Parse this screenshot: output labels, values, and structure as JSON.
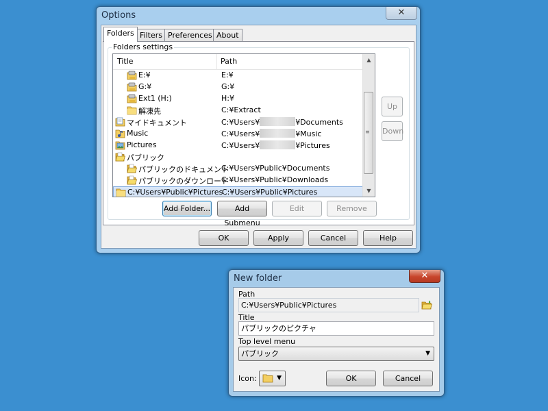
{
  "options_window": {
    "title": "Options",
    "close_glyph": "✕",
    "tabs": [
      "Folders",
      "Filters",
      "Preferences",
      "About"
    ],
    "group_label": "Folders settings",
    "columns": [
      "Title",
      "Path"
    ],
    "rows": [
      {
        "title": "E:¥",
        "path": "E:¥",
        "icon": "drive-icon",
        "indent": 1
      },
      {
        "title": "G:¥",
        "path": "G:¥",
        "icon": "drive-icon",
        "indent": 1
      },
      {
        "title": "Ext1 (H:)",
        "path": "H:¥",
        "icon": "drive-icon",
        "indent": 1
      },
      {
        "title": "解凍先",
        "path": "C:¥Extract",
        "icon": "folder-icon",
        "indent": 1
      },
      {
        "title": "マイドキュメント",
        "path_prefix": "C:¥Users¥",
        "path_suffix": "¥Documents",
        "icon": "documents-icon",
        "indent": 0
      },
      {
        "title": "Music",
        "path_prefix": "C:¥Users¥",
        "path_suffix": "¥Music",
        "icon": "music-icon",
        "indent": 0
      },
      {
        "title": "Pictures",
        "path_prefix": "C:¥Users¥",
        "path_suffix": "¥Pictures",
        "icon": "pictures-icon",
        "indent": 0
      },
      {
        "title": "パブリック",
        "path": "",
        "icon": "open-folder-icon",
        "indent": 0
      },
      {
        "title": "パブリックのドキュメント",
        "path": "C:¥Users¥Public¥Documents",
        "icon": "open-folder-icon",
        "indent": 1
      },
      {
        "title": "パブリックのダウンロード",
        "path": "C:¥Users¥Public¥Downloads",
        "icon": "open-folder-icon",
        "indent": 1
      },
      {
        "title": "C:¥Users¥Public¥Pictures",
        "path": "C:¥Users¥Public¥Pictures",
        "icon": "folder-icon",
        "indent": 0,
        "selected": true
      }
    ],
    "side_buttons": {
      "up": "Up",
      "down": "Down"
    },
    "list_buttons": {
      "add_folder": "Add Folder...",
      "add_submenu": "Add Submenu",
      "edit": "Edit",
      "remove": "Remove"
    },
    "footer_buttons": {
      "ok": "OK",
      "apply": "Apply",
      "cancel": "Cancel",
      "help": "Help"
    }
  },
  "new_folder_dialog": {
    "title": "New folder",
    "close_glyph": "✕",
    "path_label": "Path",
    "path_value": "C:¥Users¥Public¥Pictures",
    "title_label": "Title",
    "title_value": "パブリックのピクチャ",
    "menu_label": "Top level menu",
    "menu_value": "パブリック",
    "icon_label": "Icon:",
    "browse_icon": "open-folder-icon",
    "ok": "OK",
    "cancel": "Cancel"
  },
  "colors": {
    "desktop": "#3b8fd0",
    "window_frame": "#a9cfee",
    "close_active": "#c8452c",
    "selection": "#d8e6f8",
    "folder": "#f3cf63"
  }
}
